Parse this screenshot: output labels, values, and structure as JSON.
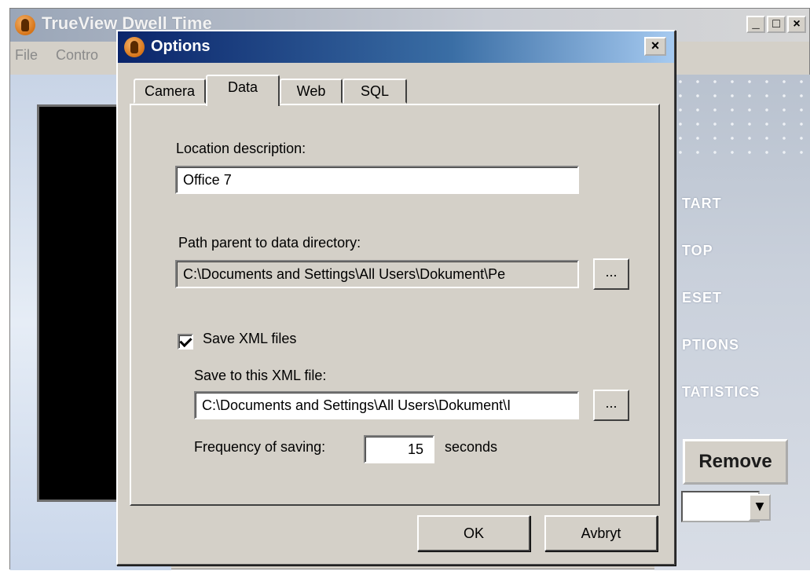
{
  "main_window": {
    "title": "TrueView Dwell Time",
    "window_controls": {
      "minimize": "_",
      "maximize": "□",
      "close": "×"
    },
    "menu": [
      "File",
      "Contro"
    ],
    "side_buttons": [
      "TART",
      "TOP",
      "ESET",
      "PTIONS",
      "TATISTICS"
    ],
    "remove_label": "Remove",
    "combo_arrow": "▼"
  },
  "dialog": {
    "title": "Options",
    "close_glyph": "×",
    "tabs": [
      {
        "label": "Camera",
        "active": false
      },
      {
        "label": "Data",
        "active": true
      },
      {
        "label": "Web",
        "active": false
      },
      {
        "label": "SQL",
        "active": false
      }
    ],
    "data_tab": {
      "location_label": "Location description:",
      "location_value": "Office 7",
      "path_label": "Path parent to data directory:",
      "path_value": "C:\\Documents and Settings\\All Users\\Dokument\\Pe",
      "browse_label": "...",
      "save_xml_checked": true,
      "save_xml_label": "Save XML files",
      "xml_file_label": "Save to this XML file:",
      "xml_file_value": "C:\\Documents and Settings\\All Users\\Dokument\\I",
      "frequency_label": "Frequency of saving:",
      "frequency_value": "15",
      "frequency_unit": "seconds"
    },
    "ok_label": "OK",
    "cancel_label": "Avbryt"
  }
}
